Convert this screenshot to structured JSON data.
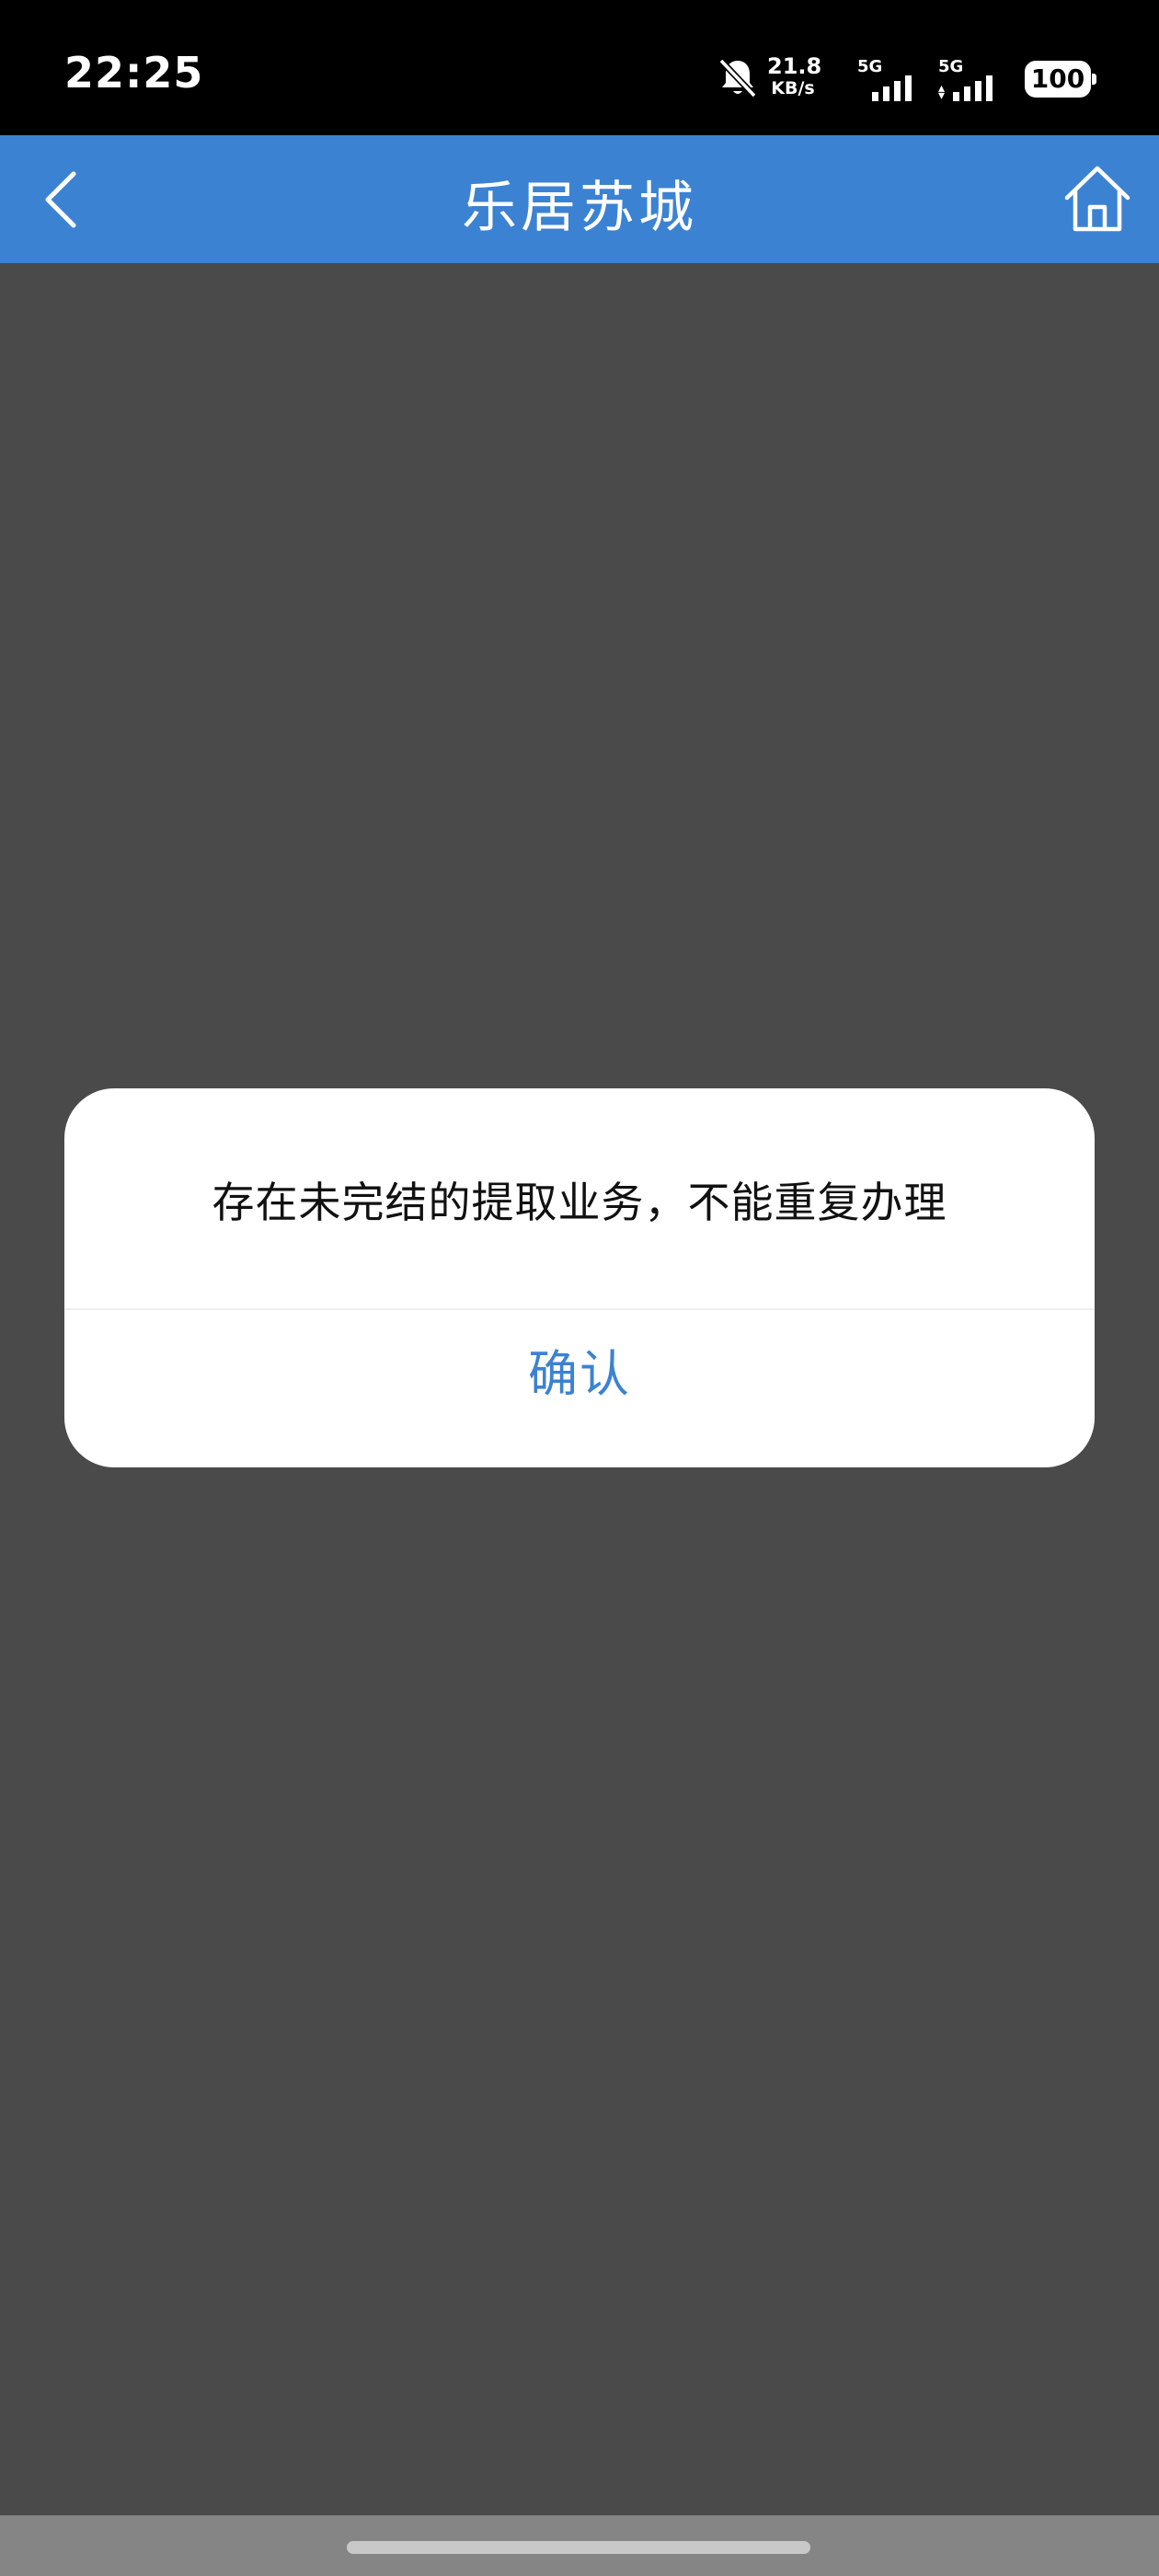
{
  "status_bar": {
    "time": "22:25",
    "net_speed_value": "21.8",
    "net_speed_unit": "KB/s",
    "sim1_label": "5G",
    "sim2_label": "5G",
    "battery": "100",
    "bell_icon": "bell-muted-icon"
  },
  "header": {
    "title": "乐居苏城",
    "back_icon": "chevron-left-icon",
    "home_icon": "home-icon",
    "background_color": "#3c82d2"
  },
  "dialog": {
    "message": "存在未完结的提取业务，不能重复办理",
    "confirm_label": "确认",
    "confirm_color": "#3c82d2"
  }
}
